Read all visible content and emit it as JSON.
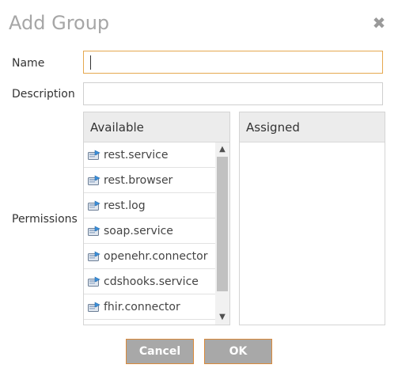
{
  "dialog": {
    "title": "Add Group",
    "close_glyph": "✖"
  },
  "form": {
    "name_label": "Name",
    "name_value": "",
    "description_label": "Description",
    "description_value": "",
    "permissions_label": "Permissions"
  },
  "permissions": {
    "available_header": "Available",
    "assigned_header": "Assigned",
    "available_items": [
      {
        "label": "rest.service",
        "icon": "permission-icon"
      },
      {
        "label": "rest.browser",
        "icon": "permission-icon"
      },
      {
        "label": "rest.log",
        "icon": "permission-icon"
      },
      {
        "label": "soap.service",
        "icon": "permission-icon"
      },
      {
        "label": "openehr.connector",
        "icon": "permission-icon"
      },
      {
        "label": "cdshooks.service",
        "icon": "permission-icon"
      },
      {
        "label": "fhir.connector",
        "icon": "permission-icon"
      }
    ],
    "assigned_items": []
  },
  "buttons": {
    "cancel_label": "Cancel",
    "ok_label": "OK"
  },
  "colors": {
    "focus_border": "#e5a84f",
    "button_bg": "#a8a8a8",
    "button_border": "#d9893a",
    "title": "#a6a6a6"
  }
}
